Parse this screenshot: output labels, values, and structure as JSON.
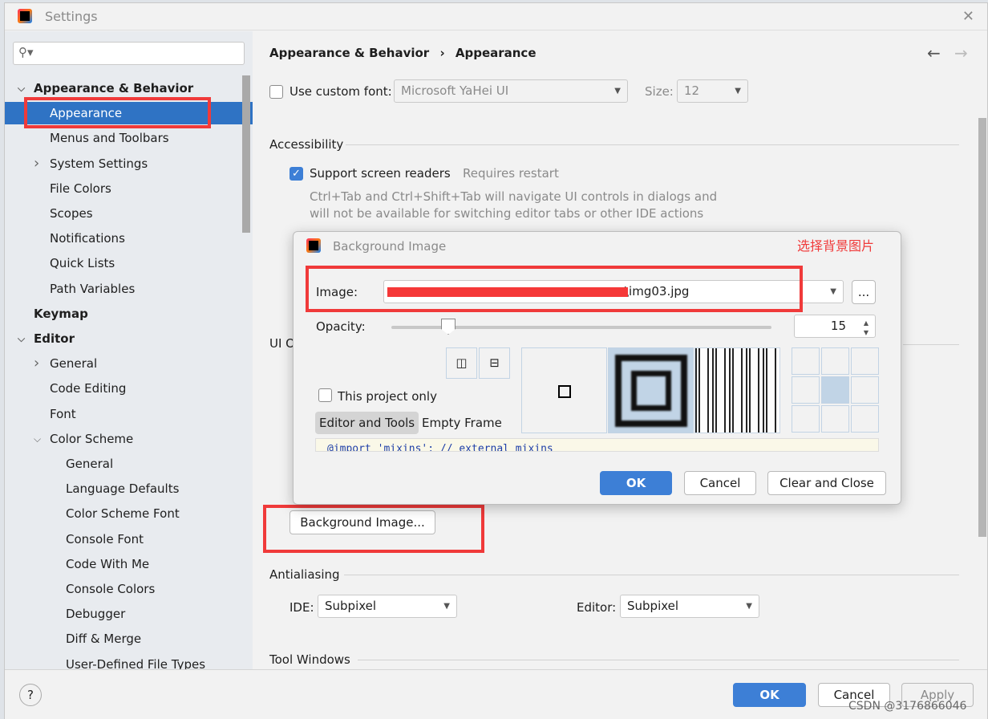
{
  "window": {
    "title": "Settings",
    "close": "✕"
  },
  "search": {
    "placeholder": ""
  },
  "sidebar": {
    "items": [
      {
        "label": "Appearance & Behavior",
        "bold": true,
        "expanded": true
      },
      {
        "label": "Appearance",
        "selected": true
      },
      {
        "label": "Menus and Toolbars"
      },
      {
        "label": "System Settings",
        "collapsed": true
      },
      {
        "label": "File Colors"
      },
      {
        "label": "Scopes"
      },
      {
        "label": "Notifications"
      },
      {
        "label": "Quick Lists"
      },
      {
        "label": "Path Variables"
      },
      {
        "label": "Keymap",
        "bold": true
      },
      {
        "label": "Editor",
        "bold": true,
        "expanded": true
      },
      {
        "label": "General",
        "collapsed": true
      },
      {
        "label": "Code Editing"
      },
      {
        "label": "Font"
      },
      {
        "label": "Color Scheme",
        "expanded": true
      },
      {
        "label": "General"
      },
      {
        "label": "Language Defaults"
      },
      {
        "label": "Color Scheme Font"
      },
      {
        "label": "Console Font"
      },
      {
        "label": "Code With Me"
      },
      {
        "label": "Console Colors"
      },
      {
        "label": "Debugger"
      },
      {
        "label": "Diff & Merge"
      },
      {
        "label": "User-Defined File Types"
      }
    ]
  },
  "breadcrumb": {
    "parent": "Appearance & Behavior",
    "sep": "›",
    "current": "Appearance"
  },
  "nav": {
    "back": "←",
    "forward": "→"
  },
  "font": {
    "label": "Use custom font:",
    "value": "Microsoft YaHei UI",
    "size_label": "Size:",
    "size": "12"
  },
  "accessibility": {
    "title": "Accessibility",
    "screen_readers": "Support screen readers",
    "requires_restart": "Requires restart",
    "note1": "Ctrl+Tab and Ctrl+Shift+Tab will navigate UI controls in dialogs and",
    "note2": "will not be available for switching editor tabs or other IDE actions"
  },
  "ui_options": {
    "title": "UI O"
  },
  "background_button": "Background Image...",
  "antialiasing": {
    "title": "Antialiasing",
    "ide_label": "IDE:",
    "ide_value": "Subpixel",
    "editor_label": "Editor:",
    "editor_value": "Subpixel"
  },
  "tool_windows": {
    "title": "Tool Windows"
  },
  "footer": {
    "help": "?",
    "ok": "OK",
    "cancel": "Cancel",
    "apply": "Apply"
  },
  "dialog": {
    "title": "Background Image",
    "annotation": "选择背景图片",
    "image_label": "Image:",
    "image_value": "\\img03.jpg",
    "browse": "...",
    "opacity_label": "Opacity:",
    "opacity_value": "15",
    "opacity_percent": 15,
    "this_project_only": "This project only",
    "tab_editor": "Editor and Tools",
    "tab_empty": "Empty Frame",
    "preview_code": "@import 'mixins'; // external mixins",
    "ok": "OK",
    "cancel": "Cancel",
    "clear_close": "Clear and Close"
  },
  "watermark": "CSDN @3176866046",
  "colors": {
    "accent": "#3d7fd6",
    "annotation": "#f03a3a"
  }
}
